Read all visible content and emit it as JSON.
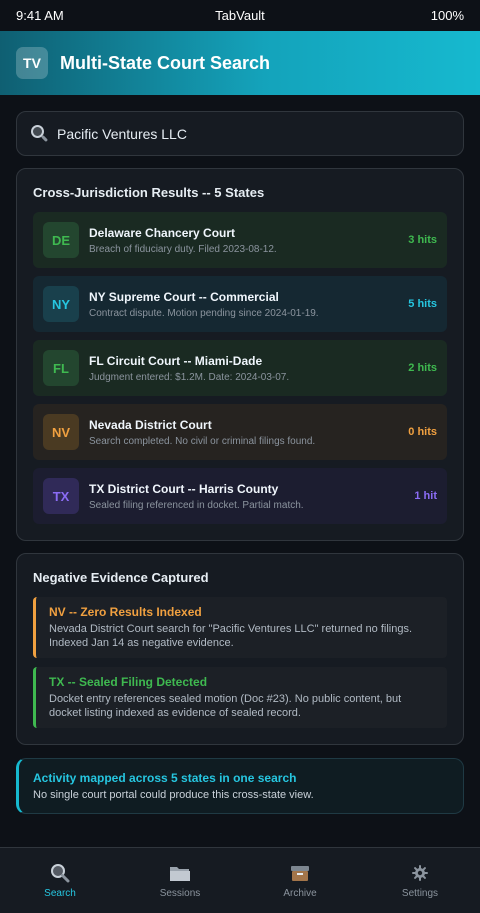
{
  "status_bar": {
    "time": "9:41 AM",
    "app": "TabVault",
    "battery": "100%"
  },
  "header": {
    "logo": "TV",
    "title": "Multi-State Court Search"
  },
  "search": {
    "value": "Pacific Ventures LLC",
    "icon": "search-icon"
  },
  "results": {
    "title": "Cross-Jurisdiction Results -- 5 States",
    "items": [
      {
        "state": "DE",
        "court": "Delaware Chancery Court",
        "desc": "Breach of fiduciary duty. Filed 2023-08-12.",
        "hits": "3 hits",
        "color": "#3fb950",
        "bg": "#1a2a22",
        "badge_bg": "#23462f"
      },
      {
        "state": "NY",
        "court": "NY Supreme Court -- Commercial",
        "desc": "Contract dispute. Motion pending since 2024-01-19.",
        "hits": "5 hits",
        "color": "#26c6e0",
        "bg": "#152832",
        "badge_bg": "#19404c"
      },
      {
        "state": "FL",
        "court": "FL Circuit Court -- Miami-Dade",
        "desc": "Judgment entered: $1.2M. Date: 2024-03-07.",
        "hits": "2 hits",
        "color": "#3fb950",
        "bg": "#1a2a22",
        "badge_bg": "#23462f"
      },
      {
        "state": "NV",
        "court": "Nevada District Court",
        "desc": "Search completed. No civil or criminal filings found.",
        "hits": "0 hits",
        "color": "#f0a040",
        "bg": "#262320",
        "badge_bg": "#4a3a22"
      },
      {
        "state": "TX",
        "court": "TX District Court -- Harris County",
        "desc": "Sealed filing referenced in docket. Partial match.",
        "hits": "1 hit",
        "color": "#8b6cf5",
        "bg": "#1c1d30",
        "badge_bg": "#302a58"
      }
    ]
  },
  "evidence": {
    "title": "Negative Evidence Captured",
    "items": [
      {
        "title": "NV -- Zero Results Indexed",
        "body": "Nevada District Court search for \"Pacific Ventures LLC\" returned no filings. Indexed Jan 14 as negative evidence.",
        "color": "#f0a040"
      },
      {
        "title": "TX -- Sealed Filing Detected",
        "body": "Docket entry references sealed motion (Doc #23). No public content, but docket listing indexed as evidence of sealed record.",
        "color": "#3fb950"
      }
    ]
  },
  "activity": {
    "title": "Activity mapped across 5 states in one search",
    "subtitle": "No single court portal could produce this cross-state view."
  },
  "nav": {
    "items": [
      {
        "label": "Search",
        "icon": "search-icon",
        "active": true
      },
      {
        "label": "Sessions",
        "icon": "folder-icon",
        "active": false
      },
      {
        "label": "Archive",
        "icon": "archive-box-icon",
        "active": false
      },
      {
        "label": "Settings",
        "icon": "gear-icon",
        "active": false
      }
    ],
    "accent": "#26c6e0"
  }
}
